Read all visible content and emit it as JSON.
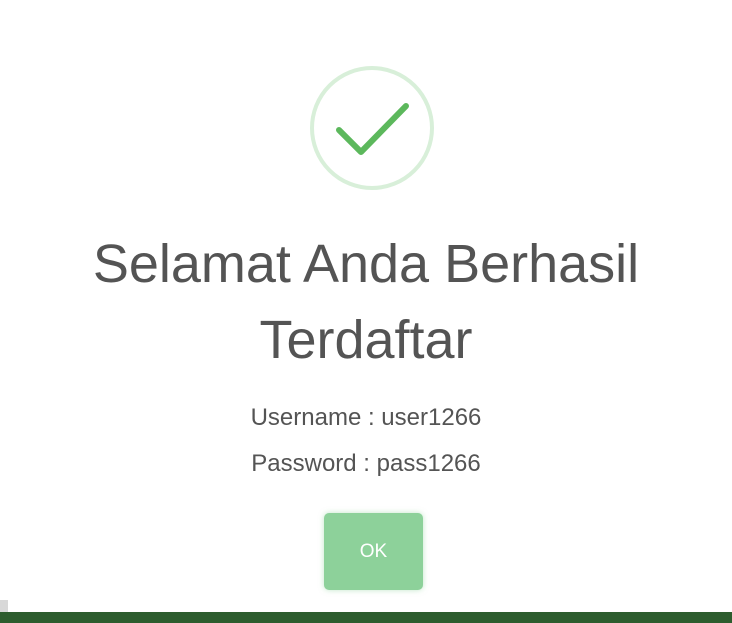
{
  "dialog": {
    "title": "Selamat Anda Berhasil Terdaftar",
    "username_line": "Username : user1266",
    "password_line": "Password : pass1266",
    "ok_label": "OK",
    "icon": "success-checkmark-icon"
  },
  "colors": {
    "accent_green": "#5cb85c",
    "ring_green": "#d8efd9",
    "button_green": "#8dd19a",
    "text_gray": "#545454",
    "bottom_bar_green": "#2d5d2e"
  }
}
